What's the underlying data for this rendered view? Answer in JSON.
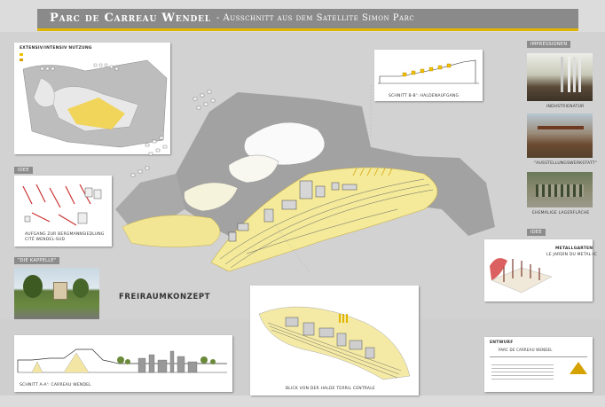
{
  "header": {
    "title": "Parc de Carreau Wendel",
    "subtitle": "- Ausschnitt aus dem Satellite Simon Parc"
  },
  "left": {
    "legend_title": "Extensiv/intensiv Nutzung",
    "tag_idee": "Idee",
    "caption_aufgang": "Aufgang zur Bergmannsiedlung Cité Wendel-Sud",
    "tag_kappelle": "\"Die Kappelle\"",
    "caption_schnitt_aa": "Schnitt A-A': Carreau Wendel"
  },
  "center": {
    "caption_schnitt_bb": "Schnitt B-B': Haldenaufgang",
    "freiraum": "Freiraumkonzept",
    "caption_blick": "Blick von der Halde Terril Centrale"
  },
  "right": {
    "tag_impressionen": "Impressionen",
    "caption_industrienatur": "Industrienatur",
    "caption_ausstellung": "\"Ausstellungswerkstatt\"",
    "caption_ehemalige": "Ehemalige Lagerfläche",
    "tag_idee2": "Idee",
    "metal_title": "Metallgarten",
    "metal_sub": "le Jardin du Metal-ic",
    "info_entwurf": "Entwurf",
    "info_line": "Parc de Carreau Wendel"
  },
  "colors": {
    "accent": "#e0b400",
    "title_bar": "#8a8a8a",
    "background": "#dcdcdc"
  }
}
